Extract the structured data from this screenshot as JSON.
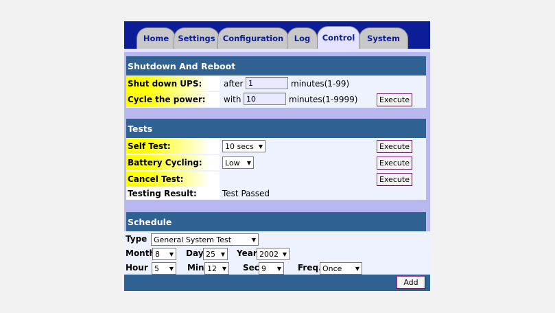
{
  "tabs": [
    "Home",
    "Settings",
    "Configuration",
    "Log",
    "Control",
    "System"
  ],
  "active_tab": "Control",
  "shutdown": {
    "title": "Shutdown And Reboot",
    "rows": [
      {
        "label": "Shut down UPS:",
        "prefix": "after",
        "value": "1",
        "suffix": "minutes(1-99)"
      },
      {
        "label": "Cycle the power:",
        "prefix": "with",
        "value": "10",
        "suffix": "minutes(1-9999)",
        "button": "Execute"
      }
    ]
  },
  "tests": {
    "title": "Tests",
    "self_test": {
      "label": "Self Test:",
      "value": "10 secs",
      "button": "Execute"
    },
    "battery": {
      "label": "Battery Cycling:",
      "value": "Low",
      "button": "Execute"
    },
    "cancel": {
      "label": "Cancel Test:",
      "button": "Execute"
    },
    "result": {
      "label": "Testing Result:",
      "value": "Test Passed"
    }
  },
  "schedule": {
    "title": "Schedule",
    "type_label": "Type",
    "type_value": "General System Test",
    "month_label": "Month",
    "month_value": "8",
    "day_label": "Day",
    "day_value": "25",
    "year_label": "Year",
    "year_value": "2002",
    "hour_label": "Hour",
    "hour_value": "5",
    "min_label": "Min",
    "min_value": "12",
    "sec_label": "Sec",
    "sec_value": "9",
    "freq_label": "Freq.",
    "freq_value": "Once",
    "add_button": "Add"
  },
  "colors": {
    "tab_bar": "#0c1d97",
    "header": "#2f6193",
    "panel": "#b8b8f0",
    "highlight": "#ffff00"
  }
}
